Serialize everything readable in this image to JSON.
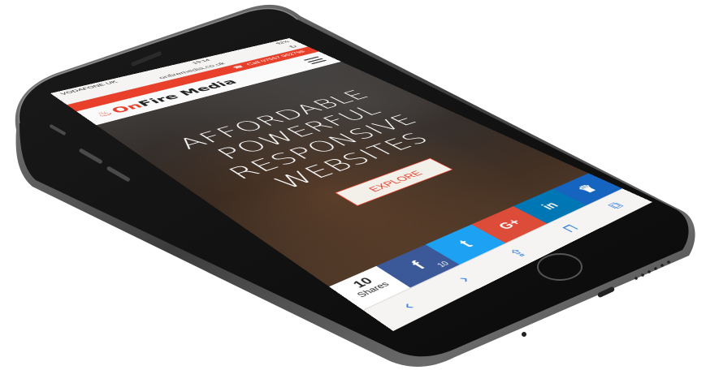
{
  "status_bar": {
    "carrier": "VODAFONE UK",
    "time": "19:14",
    "battery": "92%"
  },
  "url_bar": {
    "url": "onfiremedia.co.uk",
    "reload_icon": "reload-icon"
  },
  "call_bar": {
    "label": "Call 07557 962798",
    "icon": "phone-icon"
  },
  "site_header": {
    "logo_on": "On",
    "logo_rest": "Fire Media",
    "menu_icon": "hamburger-icon"
  },
  "hero": {
    "line1": "AFFORDABLE",
    "line2": "POWERFUL",
    "line3": "RESPONSIVE",
    "line4": "WEBSITES",
    "button_label": "EXPLORE"
  },
  "share_bar": {
    "count": "10",
    "count_label": "Shares",
    "facebook": {
      "glyph": "f",
      "count": "10"
    },
    "twitter": {
      "glyph": "t"
    },
    "googleplus": {
      "glyph": "G+"
    },
    "linkedin": {
      "glyph": "in"
    },
    "crown": {
      "glyph": "♛"
    }
  },
  "toolbar": {
    "back": "‹",
    "forward": "›",
    "share": "⇪",
    "bookmarks": "⊓",
    "tabs": "⧉"
  },
  "colors": {
    "brand": "#e8402a",
    "facebook": "#3b5998",
    "twitter": "#1da1f2",
    "googleplus": "#dd4b39",
    "linkedin": "#0077b5"
  }
}
